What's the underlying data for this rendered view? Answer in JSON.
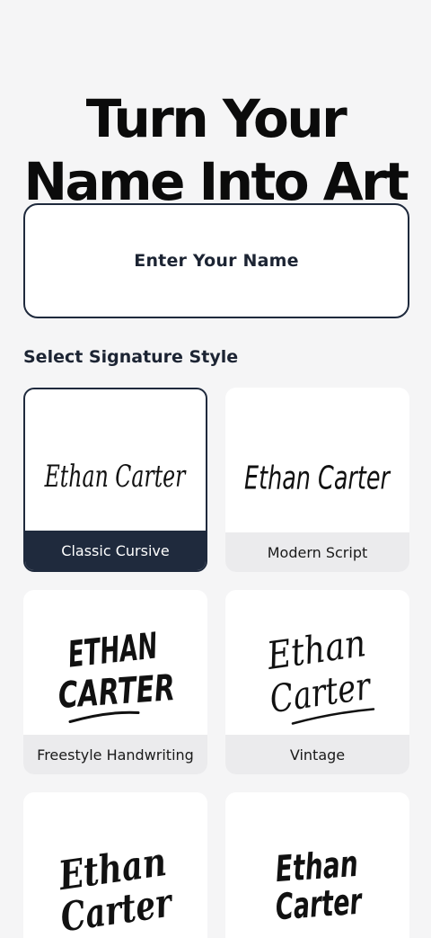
{
  "header": {
    "title_line1": "Turn Your",
    "title_line2": "Name Into Art"
  },
  "name_input": {
    "placeholder": "Enter Your Name"
  },
  "style_section": {
    "label": "Select Signature Style"
  },
  "styles": [
    {
      "label": "Classic Cursive",
      "selected": true
    },
    {
      "label": "Modern Script",
      "selected": false
    },
    {
      "label": "Freestyle Handwriting",
      "selected": false
    },
    {
      "label": "Vintage",
      "selected": false
    },
    {
      "label": "",
      "selected": false
    },
    {
      "label": "",
      "selected": false
    }
  ],
  "sample_signature": {
    "text": "Ethan Carter",
    "first": "Ethan",
    "last": "Carter",
    "first_upper": "ETHAN",
    "last_upper": "CARTER"
  },
  "colors": {
    "accent": "#1f2a3d",
    "caption_bg": "#ebebed",
    "page_bg": "#f5f5f6"
  }
}
